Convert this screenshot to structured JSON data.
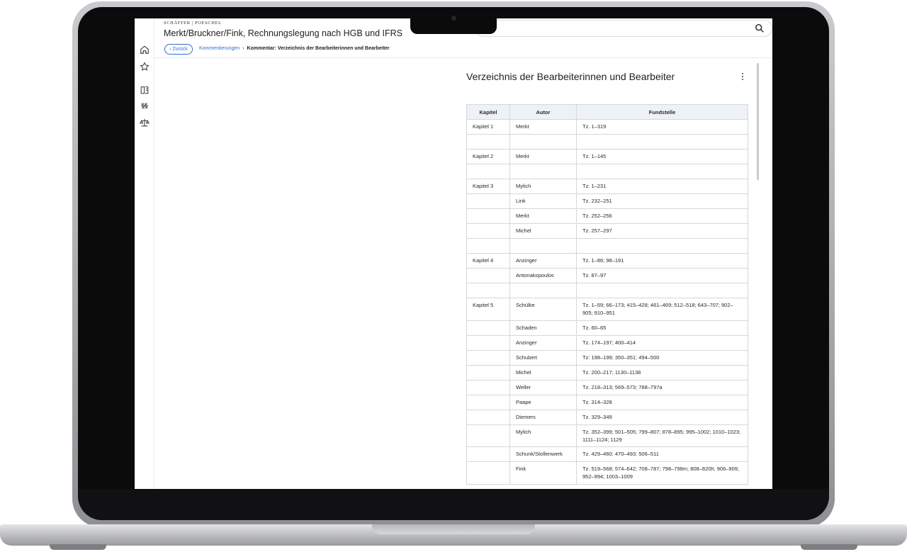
{
  "app": {
    "brand": "SCHÄFFER | POESCHEL",
    "title": "Merkt/Bruckner/Fink, Rechnungslegung nach HGB und IFRS"
  },
  "nav": {
    "back_label": "Zurück",
    "breadcrumb_link": "Kommentierungen",
    "breadcrumb_separator": "›",
    "breadcrumb_current": "Kommentar: Verzeichnis der Bearbeiterinnen und Bearbeiter"
  },
  "rail": {
    "paragraph_label": "§§"
  },
  "section": {
    "title": "Verzeichnis der Bearbeiterinnen und Bearbeiter"
  },
  "table": {
    "headers": [
      "Kapitel",
      "Autor",
      "Fundstelle"
    ],
    "rows": [
      [
        "Kapitel 1",
        "Merkt",
        "Tz. 1–319"
      ],
      [
        "",
        "",
        ""
      ],
      [
        "Kapitel 2",
        "Merkt",
        "Tz. 1–145"
      ],
      [
        "",
        "",
        ""
      ],
      [
        "Kapitel 3",
        "Mylich",
        "Tz. 1–231"
      ],
      [
        "",
        "Link",
        "Tz. 232–251"
      ],
      [
        "",
        "Merkt",
        "Tz. 252–256"
      ],
      [
        "",
        "Michel",
        "Tz. 257–297"
      ],
      [
        "",
        "",
        ""
      ],
      [
        "Kapitel 4",
        "Anzinger",
        "Tz. 1–86; 98–191"
      ],
      [
        "",
        "Antonakopoulos",
        "Tz. 87–97"
      ],
      [
        "",
        "",
        ""
      ],
      [
        "Kapitel 5",
        "Schülke",
        "Tz. 1–59; 66–173; 415–428; 461–469; 512–518; 643–707; 902–905; 910–951"
      ],
      [
        "",
        "Schaden",
        "Tz. 60–65"
      ],
      [
        "",
        "Anzinger",
        "Tz. 174–197; 400–414"
      ],
      [
        "",
        "Schubert",
        "Tz: 198–199; 350–351; 494–500"
      ],
      [
        "",
        "Michel",
        "Tz. 200–217; 1130–1138"
      ],
      [
        "",
        "Weller",
        "Tz. 218–313; 569–573; 788–797a"
      ],
      [
        "",
        "Paape",
        "Tz. 314–328"
      ],
      [
        "",
        "Diemers",
        "Tz. 329–349"
      ],
      [
        "",
        "Mylich",
        "Tz. 352–399; 501–505; 799–807; 878–895; 995–1002; 1010–1023; 1111–1124; 1129"
      ],
      [
        "",
        "Schunk/Stollenwerk",
        "Tz. 429–460; 470–493; 506–511"
      ],
      [
        "",
        "Fink",
        "Tz. 519–568; 574–642; 708–787; 798–798m; 808–820h; 906–909; 952–994; 1003–1009"
      ]
    ]
  },
  "colors": {
    "accent": "#2f6fd1",
    "table_header_bg": "#eef1f6",
    "border": "#d3d7dd"
  }
}
